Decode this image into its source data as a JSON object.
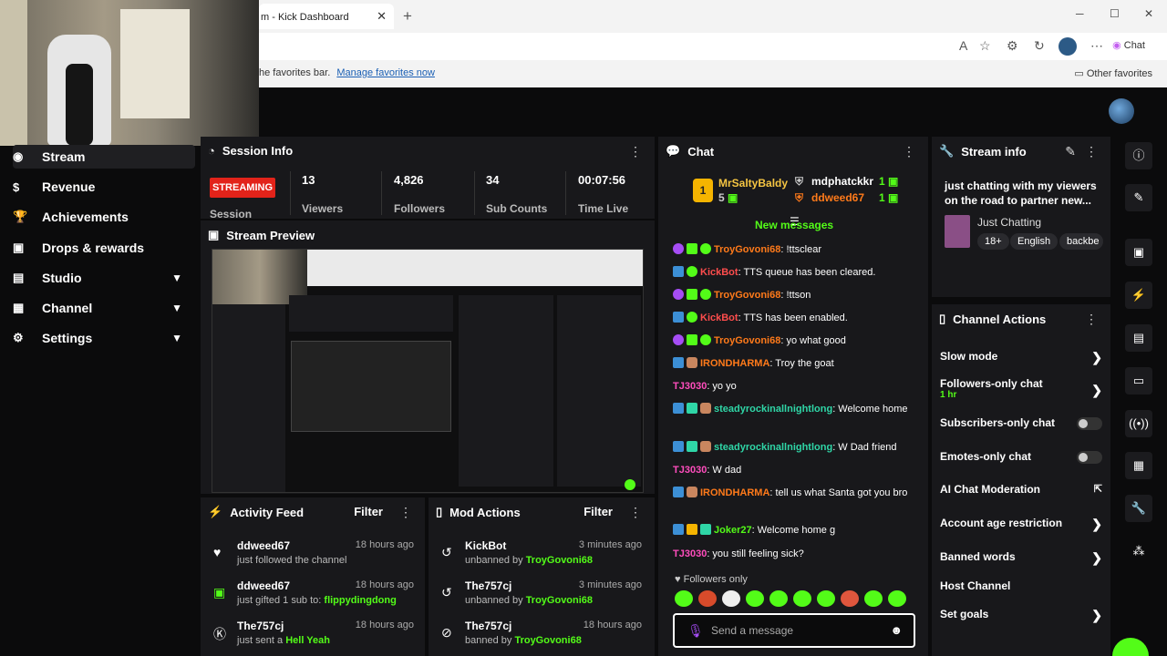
{
  "browser": {
    "tab_title": "m - Kick Dashboard",
    "favorites_text": "he favorites bar.",
    "manage_favorites": "Manage favorites now",
    "other_favorites": "Other favorites",
    "chat_button": "Chat"
  },
  "sidebar": {
    "items": [
      {
        "label": "Stream",
        "icon": "stream-icon"
      },
      {
        "label": "Revenue",
        "icon": "dollar-icon"
      },
      {
        "label": "Achievements",
        "icon": "trophy-icon"
      },
      {
        "label": "Drops & rewards",
        "icon": "gift-icon"
      },
      {
        "label": "Studio",
        "icon": "studio-icon"
      },
      {
        "label": "Channel",
        "icon": "channel-icon"
      },
      {
        "label": "Settings",
        "icon": "gear-icon"
      }
    ]
  },
  "session": {
    "title": "Session Info",
    "status": "STREAMING",
    "status_sub": "Session",
    "stats": [
      {
        "value": "13",
        "label": "Viewers"
      },
      {
        "value": "4,826",
        "label": "Followers"
      },
      {
        "value": "34",
        "label": "Sub Counts"
      },
      {
        "value": "00:07:56",
        "label": "Time Live"
      }
    ]
  },
  "preview": {
    "title": "Stream Preview"
  },
  "activity": {
    "title": "Activity Feed",
    "filter": "Filter",
    "items": [
      {
        "name": "ddweed67",
        "time": "18 hours ago",
        "desc": "just followed the channel",
        "highlight": ""
      },
      {
        "name": "ddweed67",
        "time": "18 hours ago",
        "desc": "just gifted 1 sub to:",
        "highlight": "flippydingdong"
      },
      {
        "name": "The757cj",
        "time": "18 hours ago",
        "desc": "just sent a",
        "highlight": "Hell Yeah"
      }
    ]
  },
  "mod": {
    "title": "Mod Actions",
    "filter": "Filter",
    "items": [
      {
        "name": "KickBot",
        "time": "3 minutes ago",
        "desc": "unbanned by",
        "highlight": "TroyGovoni68"
      },
      {
        "name": "The757cj",
        "time": "3 minutes ago",
        "desc": "unbanned by",
        "highlight": "TroyGovoni68"
      },
      {
        "name": "The757cj",
        "time": "18 hours ago",
        "desc": "banned by",
        "highlight": "TroyGovoni68"
      }
    ]
  },
  "chat": {
    "title": "Chat",
    "leaderboard": {
      "rank": "1",
      "first_name": "MrSaltyBaldy",
      "first_count": "5",
      "second_name": "mdphatckkr",
      "second_count": "1",
      "third_name": "ddweed67",
      "third_count": "1"
    },
    "new_messages": "New messages",
    "messages": [
      {
        "user": "TroyGovoni68",
        "text": ": !ttsclear"
      },
      {
        "user": "KickBot",
        "text": ": TTS queue has been cleared."
      },
      {
        "user": "TroyGovoni68",
        "text": ": !ttson"
      },
      {
        "user": "KickBot",
        "text": ": TTS has been enabled."
      },
      {
        "user": "TroyGovoni68",
        "text": ": yo what good"
      },
      {
        "user": "IRONDHARMA",
        "text": ": Troy the goat"
      },
      {
        "user": "TJ3030",
        "text": ": yo yo"
      },
      {
        "user": "steadyrockinallnightlong",
        "text": ": Welcome home"
      },
      {
        "user": "steadyrockinallnightlong",
        "text": ": W Dad friend"
      },
      {
        "user": "TJ3030",
        "text": ": W dad"
      },
      {
        "user": "IRONDHARMA",
        "text": ": tell us what Santa got you bro"
      },
      {
        "user": "Joker27",
        "text": ": Welcome home g"
      },
      {
        "user": "TJ3030",
        "text": ": you still feeling sick?"
      }
    ],
    "followers_only": "Followers only",
    "placeholder": "Send a message"
  },
  "stream_info": {
    "title": "Stream info",
    "stream_title": "just chatting with my viewers on the road to partner new...",
    "category": "Just Chatting",
    "tags": [
      "18+",
      "English",
      "backbe"
    ]
  },
  "channel_actions": {
    "title": "Channel Actions",
    "items": [
      {
        "label": "Slow mode",
        "sub": ""
      },
      {
        "label": "Followers-only chat",
        "sub": "1 hr"
      },
      {
        "label": "Subscribers-only chat",
        "sub": ""
      },
      {
        "label": "Emotes-only chat",
        "sub": ""
      },
      {
        "label": "AI Chat Moderation",
        "sub": ""
      },
      {
        "label": "Account age restriction",
        "sub": ""
      },
      {
        "label": "Banned words",
        "sub": ""
      },
      {
        "label": "Host Channel",
        "sub": ""
      },
      {
        "label": "Set goals",
        "sub": ""
      }
    ]
  },
  "colors": {
    "accent": "#53fc18",
    "live": "#e2231a",
    "panel": "#18181b"
  }
}
